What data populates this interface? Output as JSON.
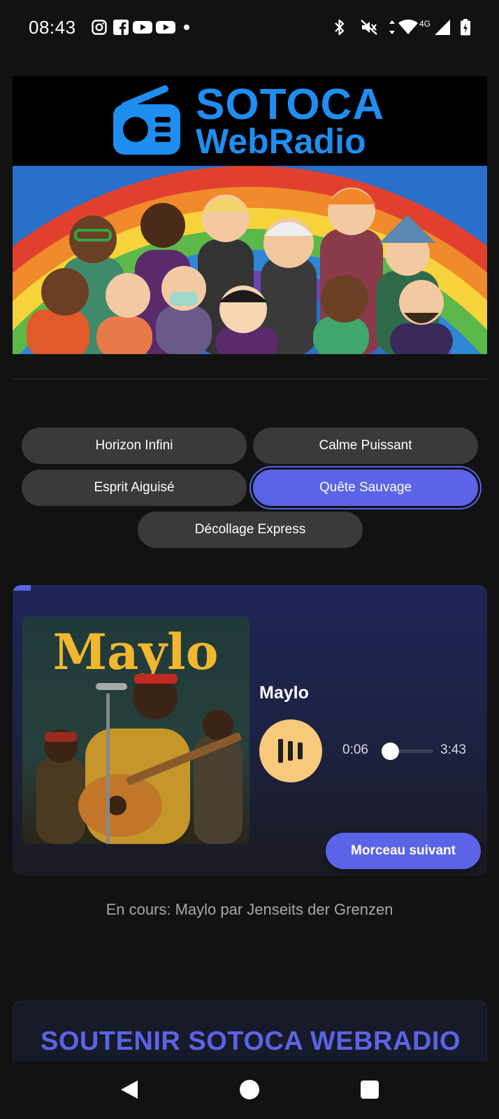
{
  "status_bar": {
    "time": "08:43",
    "network": "4G",
    "icons": [
      "instagram-icon",
      "facebook-icon",
      "youtube-icon",
      "youtube-icon",
      "dot-icon",
      "bluetooth-icon",
      "mute-icon",
      "data-arrows-icon",
      "wifi-icon",
      "signal-icon",
      "battery-icon"
    ]
  },
  "banner": {
    "logo_line1": "SOTOCA",
    "logo_line2": "WebRadio",
    "brand_color": "#1e8ef0"
  },
  "stations": [
    {
      "label": "Horizon Infini",
      "active": false
    },
    {
      "label": "Calme Puissant",
      "active": false
    },
    {
      "label": "Esprit Aiguisé",
      "active": false
    },
    {
      "label": "Quête Sauvage",
      "active": true
    },
    {
      "label": "Décollage Express",
      "active": false
    }
  ],
  "player": {
    "album_text": "Maylo",
    "track_title": "Maylo",
    "time_current": "0:06",
    "time_total": "3:43",
    "progress_fraction": 0.03,
    "play_state": "playing",
    "next_label": "Morceau suivant",
    "accent_color": "#5b63e6",
    "play_button_color": "#f7c97a"
  },
  "now_playing": "En cours: Maylo par Jenseits der Grenzen",
  "support": {
    "title": "SOUTENIR SOTOCA WEBRADIO"
  },
  "nav": {
    "icons": [
      "back-icon",
      "home-icon",
      "recents-icon"
    ]
  }
}
